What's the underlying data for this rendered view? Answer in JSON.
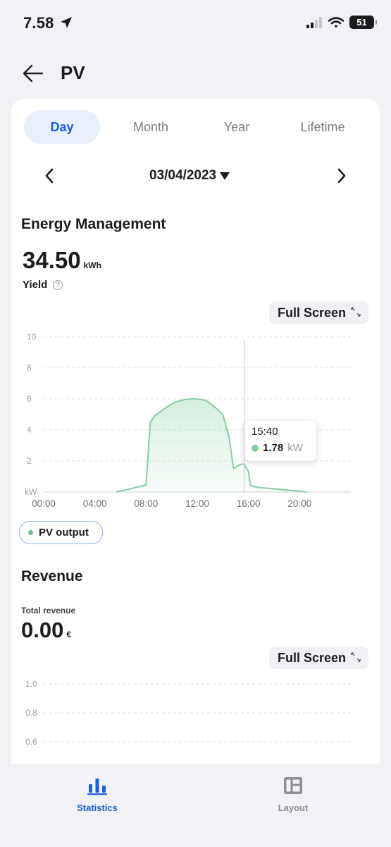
{
  "status_bar": {
    "time": "7.58",
    "battery": "51"
  },
  "header": {
    "title": "PV"
  },
  "tabs": [
    {
      "label": "Day",
      "active": true
    },
    {
      "label": "Month",
      "active": false
    },
    {
      "label": "Year",
      "active": false
    },
    {
      "label": "Lifetime",
      "active": false
    }
  ],
  "date": {
    "value": "03/04/2023"
  },
  "energy": {
    "title": "Energy Management",
    "value": "34.50",
    "unit": "kWh",
    "yield_label": "Yield",
    "full_screen_label": "Full Screen"
  },
  "tooltip": {
    "time": "15:40",
    "value": "1.78",
    "unit": "kW"
  },
  "legend": {
    "label": "PV output"
  },
  "revenue": {
    "title": "Revenue",
    "total_label": "Total revenue",
    "value": "0.00",
    "unit": "€",
    "full_screen_label": "Full Screen"
  },
  "nav": {
    "statistics": "Statistics",
    "layout": "Layout"
  },
  "colors": {
    "accent": "#1d5fe0",
    "pv_series": "#86cea0",
    "active_tab_bg": "#e9f0fc"
  },
  "chart_data": [
    {
      "type": "area",
      "ylabel": "kW",
      "ylim": [
        0,
        10
      ],
      "yticks": [
        2,
        4,
        6,
        8,
        10
      ],
      "xticks": [
        "00:00",
        "04:00",
        "08:00",
        "12:00",
        "16:00",
        "20:00"
      ],
      "xlim": [
        "00:00",
        "24:00"
      ],
      "grid": true,
      "legend": "bottom-left",
      "series": [
        {
          "name": "PV output",
          "color": "#86cea0",
          "x": [
            "05:40",
            "06:30",
            "07:15",
            "08:00",
            "08:20",
            "08:40",
            "09:00",
            "09:40",
            "10:20",
            "11:00",
            "11:40",
            "12:20",
            "12:40",
            "13:20",
            "14:00",
            "14:30",
            "14:50",
            "15:10",
            "15:30",
            "15:40",
            "16:00",
            "16:10",
            "16:40",
            "17:20",
            "18:00",
            "18:40",
            "19:20",
            "20:00",
            "20:30"
          ],
          "values": [
            0,
            0.15,
            0.3,
            0.45,
            4.5,
            4.9,
            5.1,
            5.5,
            5.8,
            5.95,
            6.0,
            5.95,
            5.9,
            5.5,
            5.0,
            3.5,
            1.5,
            1.7,
            1.8,
            1.78,
            1.3,
            0.4,
            0.3,
            0.25,
            0.2,
            0.15,
            0.1,
            0.05,
            0
          ]
        }
      ],
      "cursor_x": "15:40"
    },
    {
      "type": "line",
      "yticks": [
        "1.0",
        "0.8",
        "0.6"
      ],
      "grid": true
    }
  ]
}
